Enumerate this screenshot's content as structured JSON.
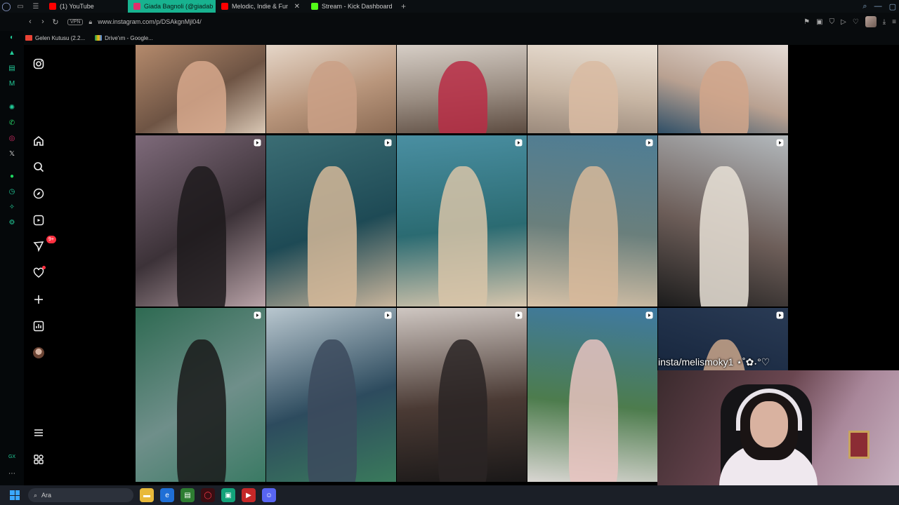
{
  "tabs": [
    {
      "label": "(1) YouTube",
      "favicon_color": "#ff0000",
      "active": false
    },
    {
      "label": "Giada Bagnoli (@giadab",
      "favicon_color": "#e1306c",
      "active": true
    },
    {
      "label": "Melodic, Indie & Funk",
      "favicon_color": "#ff0000",
      "active": false,
      "closable": true
    },
    {
      "label": "Stream - Kick Dashboard",
      "favicon_color": "#53fc18",
      "active": false
    }
  ],
  "address": {
    "vpn_label": "VPN",
    "url": "www.instagram.com/p/DSAkgnMjl04/"
  },
  "bookmarks": [
    {
      "label": "Gelen Kutusu (2.2...",
      "favicon_color": "#ea4335"
    },
    {
      "label": "Drive'ım - Google...",
      "favicon_color": "#fbbc04"
    }
  ],
  "ig_sidebar": {
    "messages_badge": "9+"
  },
  "grid": [
    {
      "colors": [
        "#b48a6c",
        "#6e5444",
        "#d9c7b4"
      ],
      "figure": "#d7a88c",
      "reel": false
    },
    {
      "colors": [
        "#e5d6c8",
        "#b9967c",
        "#8a6a53"
      ],
      "figure": "#caa086",
      "reel": false
    },
    {
      "colors": [
        "#d6cec6",
        "#9a8d82",
        "#5c4b40"
      ],
      "figure": "#b92d45",
      "reel": false
    },
    {
      "colors": [
        "#e9dfd4",
        "#c8b6a4",
        "#9b8a7c"
      ],
      "figure": "#d9bba2",
      "reel": false
    },
    {
      "colors": [
        "#e5dcd6",
        "#b9a191",
        "#2f4f67"
      ],
      "figure": "#d1a68b",
      "reel": false
    },
    {
      "colors": [
        "#7e6a7a",
        "#3c3238",
        "#b9a3a8"
      ],
      "figure": "#1d1a1c",
      "reel": true
    },
    {
      "colors": [
        "#3b6d74",
        "#1e4a55",
        "#c9b59c"
      ],
      "figure": "#d5b999",
      "reel": true
    },
    {
      "colors": [
        "#4a8fa2",
        "#2b6b72",
        "#d7c6ad"
      ],
      "figure": "#d8c4a8",
      "reel": true
    },
    {
      "colors": [
        "#4e7d95",
        "#6a7f7c",
        "#d6c1a7"
      ],
      "figure": "#d7b89a",
      "reel": true
    },
    {
      "colors": [
        "#b3b9bd",
        "#6c5d58",
        "#1c1c1c"
      ],
      "figure": "#e8e1d6",
      "reel": true
    },
    {
      "colors": [
        "#2e6a52",
        "#6f8f8a",
        "#3a7a64"
      ],
      "figure": "#1a1a1a",
      "reel": true
    },
    {
      "colors": [
        "#b9c7cf",
        "#2d4b5e",
        "#3a7a5c"
      ],
      "figure": "#3c4a5d",
      "reel": true
    },
    {
      "colors": [
        "#cfc7c2",
        "#4a3a34",
        "#1a1818"
      ],
      "figure": "#2a2424",
      "reel": true
    },
    {
      "colors": [
        "#3f7aa2",
        "#4d7c4d",
        "#d9d6d2"
      ],
      "figure": "#e7c3c0",
      "reel": true
    },
    {
      "colors": [
        "#2a3b55",
        "#14233a",
        "#0b1220"
      ],
      "figure": "#c9a589",
      "reel": true
    }
  ],
  "overlay": {
    "text": "insta/melismoky1 ⋆˚✿˖°♡"
  },
  "taskbar": {
    "search_placeholder": "Ara"
  }
}
